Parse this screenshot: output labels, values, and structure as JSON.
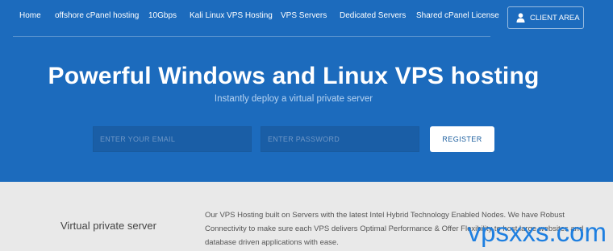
{
  "nav": {
    "items": [
      {
        "label": "Home"
      },
      {
        "label": "offshore cPanel hosting"
      },
      {
        "label": "10Gbps"
      },
      {
        "label": "Kali Linux VPS Hosting"
      },
      {
        "label": "VPS Servers"
      },
      {
        "label": "Dedicated Servers"
      },
      {
        "label": "Shared cPanel License"
      }
    ],
    "client_area": {
      "label": "CLIENT AREA",
      "icon": "user-icon"
    }
  },
  "hero": {
    "title": "Powerful Windows and Linux VPS hosting",
    "subtitle": "Instantly deploy a virtual private server",
    "email_placeholder": "ENTER YOUR EMAIL",
    "password_placeholder": "ENTER PASSWORD",
    "register_label": "REGISTER"
  },
  "feature": {
    "title": "Virtual private server",
    "description": "Our VPS Hosting built on Servers with the latest Intel Hybrid Technology Enabled Nodes. We have Robust Connectivity to make sure each VPS delivers Optimal Performance & Offer Flexibility to host large websites and database driven applications with ease."
  },
  "watermark": "vpsxxs.com",
  "colors": {
    "hero_bg": "#1c6bbd",
    "input_bg": "#1a5ea6",
    "lower_bg": "#e9e9e9",
    "watermark": "#1e7fe0"
  }
}
